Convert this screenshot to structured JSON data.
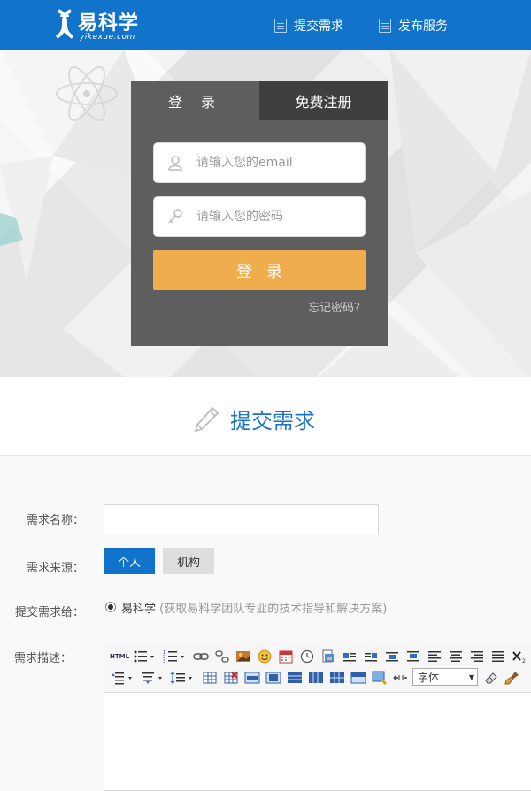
{
  "header": {
    "logo_text": "易科学",
    "logo_sub": "yikexue.com",
    "nav": [
      {
        "label": "提交需求"
      },
      {
        "label": "发布服务"
      }
    ]
  },
  "login": {
    "tab_login": "登 录",
    "tab_register": "免费注册",
    "email_placeholder": "请输入您的email",
    "password_placeholder": "请输入您的密码",
    "submit_label": "登录",
    "forgot_label": "忘记密码？"
  },
  "section": {
    "title": "提交需求"
  },
  "form": {
    "name_label": "需求名称：",
    "name_value": "",
    "source_label": "需求来源：",
    "source_options": [
      "个人",
      "机构"
    ],
    "submit_to_label": "提交需求给：",
    "submit_to_value": "易科学",
    "submit_to_note": "(获取易科学团队专业的技术指导和解决方案)",
    "desc_label": "需求描述：",
    "editor": {
      "html_button": "HTML",
      "font_select": "字体"
    }
  },
  "colors": {
    "brand_blue": "#1173c9",
    "login_orange": "#f0ad4e",
    "panel_gray": "#5e5e5e"
  }
}
